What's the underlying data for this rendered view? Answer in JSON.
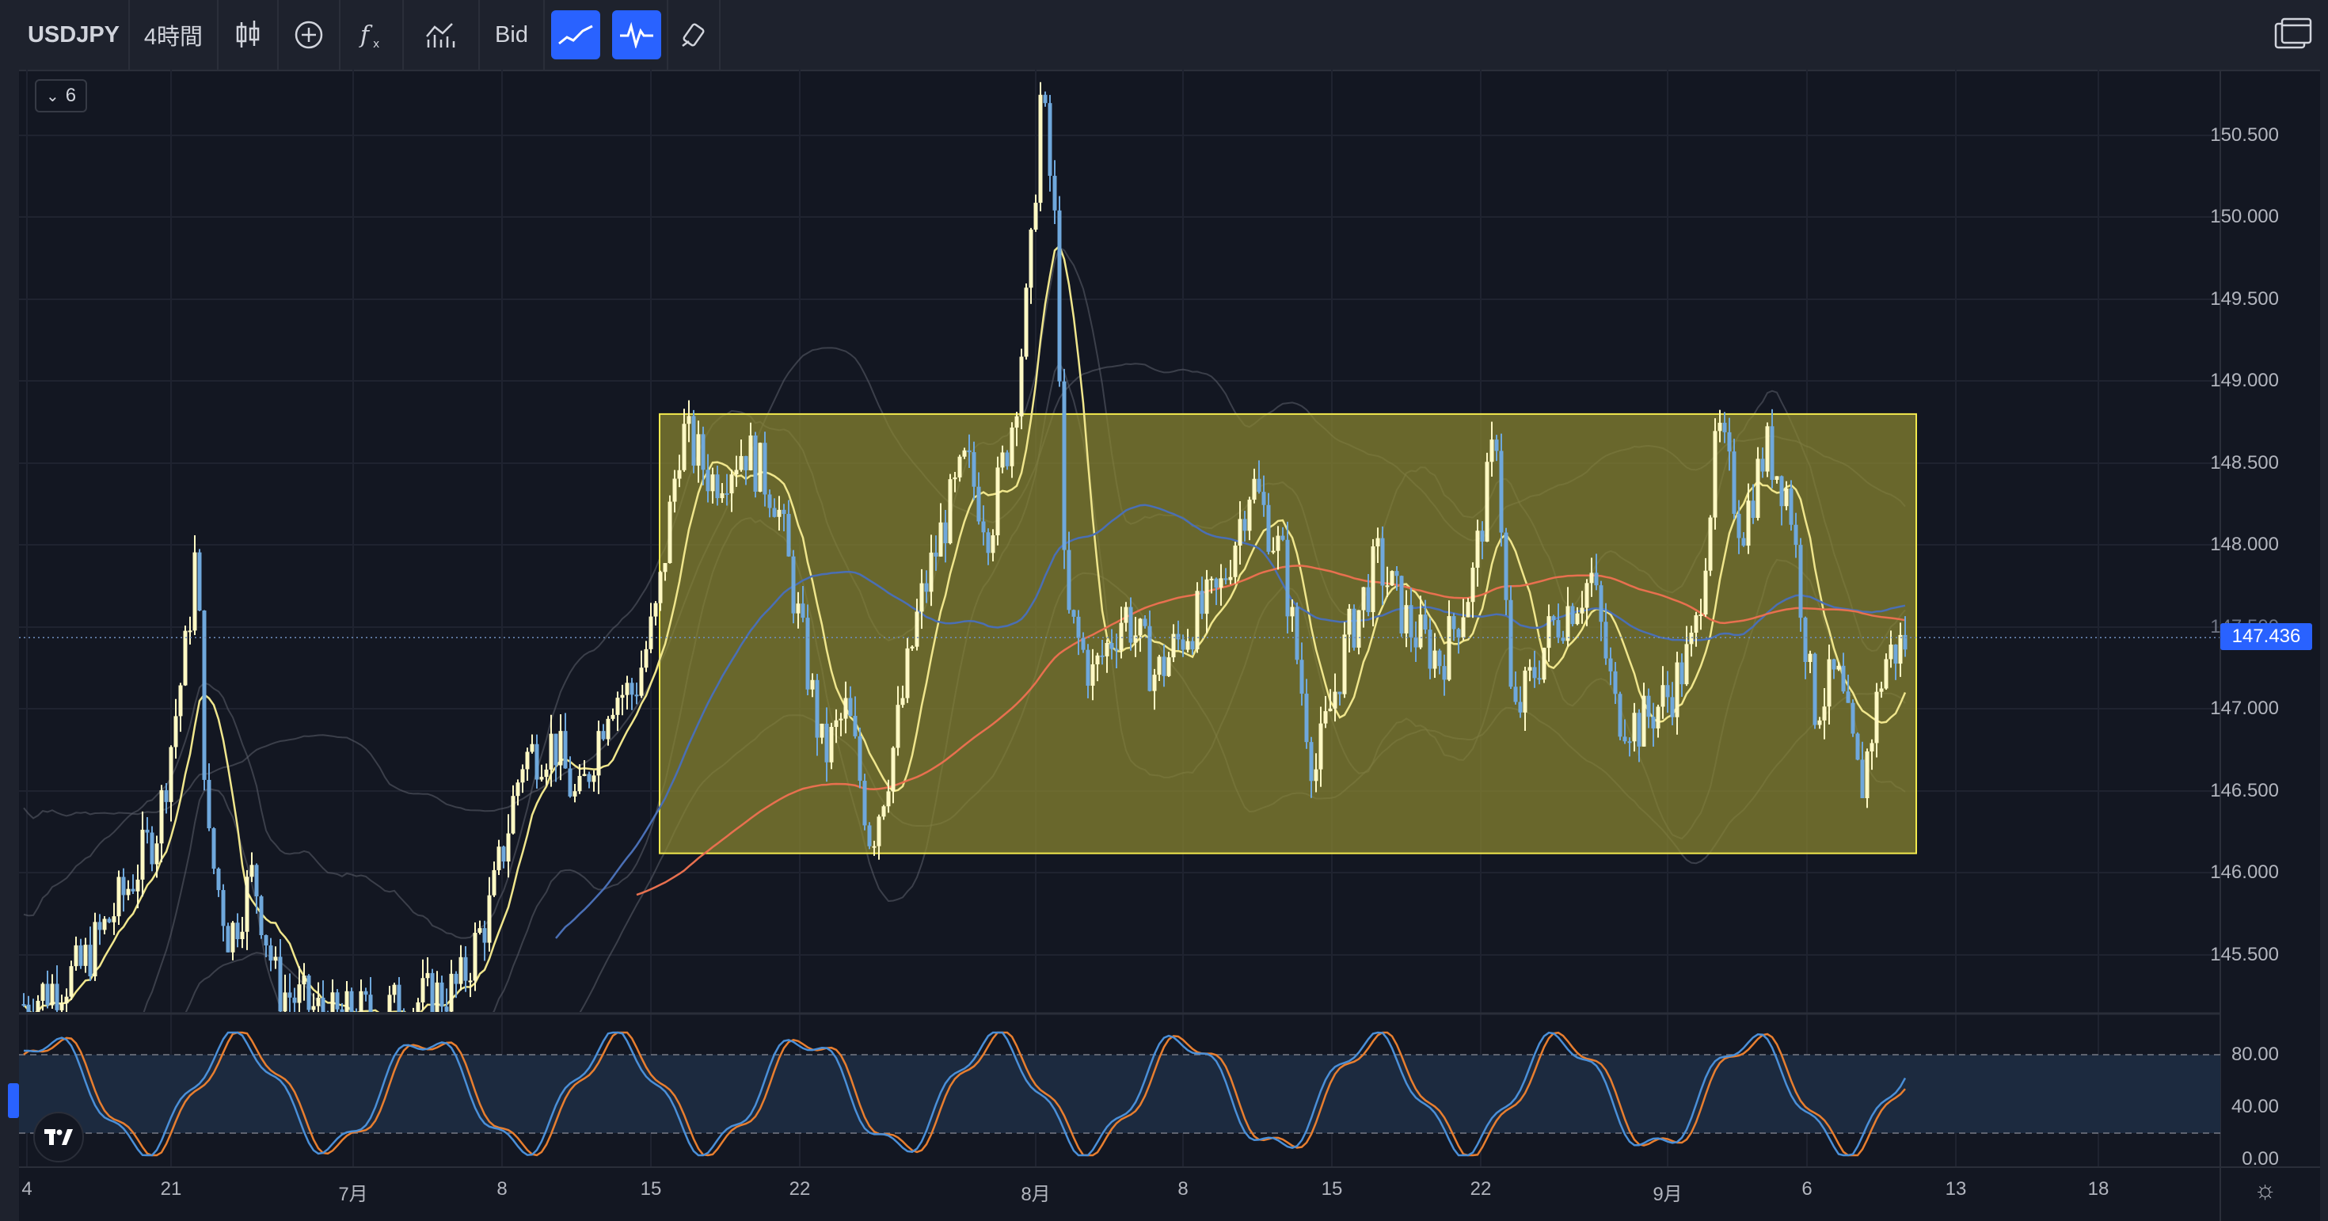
{
  "toolbar": {
    "symbol": "USDJPY",
    "interval": "4時間",
    "price_type": "Bid",
    "icons": [
      "candles-icon",
      "compare-plus-icon",
      "indicators-fx-icon",
      "templates-icon",
      "trend-tool-icon",
      "pattern-tool-icon",
      "brush-icon",
      "layout-icon"
    ]
  },
  "legend": {
    "collapsed_count": "6"
  },
  "price_axis": {
    "labels": [
      "150.500",
      "150.000",
      "149.500",
      "149.000",
      "148.500",
      "148.000",
      "147.500",
      "147.000",
      "146.500",
      "146.000",
      "145.500"
    ],
    "last_price": "147.436",
    "last_price_color": "#2962ff"
  },
  "oscillator_axis": {
    "labels": [
      "80.00",
      "40.00",
      "0.00"
    ]
  },
  "time_axis": {
    "labels": [
      "4",
      "21",
      "7月",
      "8",
      "15",
      "22",
      "8月",
      "8",
      "15",
      "22",
      "9月",
      "6",
      "13",
      "18"
    ]
  },
  "colors": {
    "background": "#131722",
    "up_candle": "#fff9c4",
    "down_candle": "#6fa8dc",
    "box_fill": "#8a8630",
    "box_border": "#f2e94e",
    "ma_yellow": "#f0e68c",
    "ma_blue": "#4a6fb5",
    "ma_red": "#e8704f",
    "stoch_blue": "#4a8fd8",
    "stoch_orange": "#e87e2f",
    "stoch_band": "#1c2a3f"
  },
  "chart_data": {
    "type": "candlestick",
    "symbol": "USDJPY",
    "interval": "4時間",
    "ylim": [
      145.2,
      150.9
    ],
    "range_box": {
      "from_date": "7月16",
      "to_date": "9月10",
      "upper": 148.8,
      "lower": 146.12
    },
    "key_prices": [
      {
        "date": "6月21",
        "high": 148.0
      },
      {
        "date": "7月31",
        "high": 150.8
      },
      {
        "date": "7月25",
        "low": 145.9
      },
      {
        "date": "8月14",
        "low": 146.25
      },
      {
        "date": "9月8",
        "low": 146.35
      }
    ],
    "oscillator": {
      "type": "stochastic",
      "ylim": [
        0,
        100
      ],
      "levels": [
        80,
        20
      ],
      "last": 75
    }
  }
}
